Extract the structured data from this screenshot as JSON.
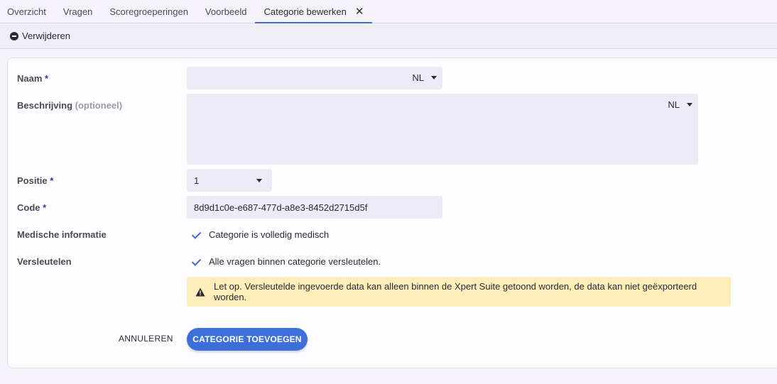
{
  "tabs": [
    {
      "label": "Overzicht"
    },
    {
      "label": "Vragen"
    },
    {
      "label": "Scoregroeperingen"
    },
    {
      "label": "Voorbeeld"
    },
    {
      "label": "Categorie bewerken",
      "active": true,
      "close_glyph": "✕"
    }
  ],
  "toolbar": {
    "delete_label": "Verwijderen",
    "delete_icon": "minus-circle-icon"
  },
  "form": {
    "naam": {
      "label": "Naam",
      "required_mark": "*",
      "value": "",
      "lang": "NL"
    },
    "beschrijving": {
      "label": "Beschrijving",
      "optional_text": "(optioneel)",
      "value": "",
      "lang": "NL"
    },
    "positie": {
      "label": "Positie",
      "required_mark": "*",
      "value": "1"
    },
    "code": {
      "label": "Code",
      "required_mark": "*",
      "value": "8d9d1c0e-e687-477d-a8e3-8452d2715d5f"
    },
    "medisch": {
      "label": "Medische informatie",
      "check_text": "Categorie is volledig medisch",
      "checked": true
    },
    "versleutelen": {
      "label": "Versleutelen",
      "check_text": "Alle vragen binnen categorie versleutelen.",
      "checked": true
    }
  },
  "warning": {
    "text": "Let op. Versleutelde ingevoerde data kan alleen binnen de Xpert Suite getoond worden, de data kan niet geëxporteerd worden.",
    "icon": "warning-triangle-icon"
  },
  "actions": {
    "cancel_label": "ANNULEREN",
    "submit_label": "CATEGORIE TOEVOEGEN"
  },
  "colors": {
    "accent": "#3e6fd8",
    "warning_bg": "#fdeeb9",
    "field_bg": "#ecebf5"
  }
}
